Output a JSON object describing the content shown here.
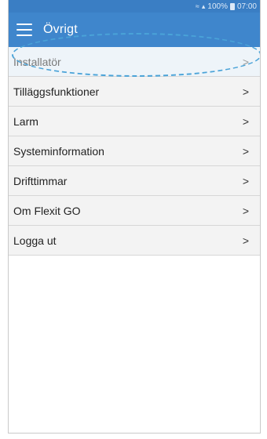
{
  "status_bar": {
    "battery": "100%",
    "time": "07:00"
  },
  "app_bar": {
    "title": "Övrigt",
    "menu_icon": "hamburger-menu-icon"
  },
  "menu_items": [
    {
      "label": "Installatör",
      "highlighted": true
    },
    {
      "label": "Tilläggsfunktioner"
    },
    {
      "label": "Larm"
    },
    {
      "label": "Systeminformation"
    },
    {
      "label": "Drifttimmar"
    },
    {
      "label": "Om Flexit GO"
    },
    {
      "label": "Logga ut"
    }
  ],
  "chevron": ">",
  "colors": {
    "primary": "#3f86cc",
    "highlight": "#4aa3d8"
  }
}
